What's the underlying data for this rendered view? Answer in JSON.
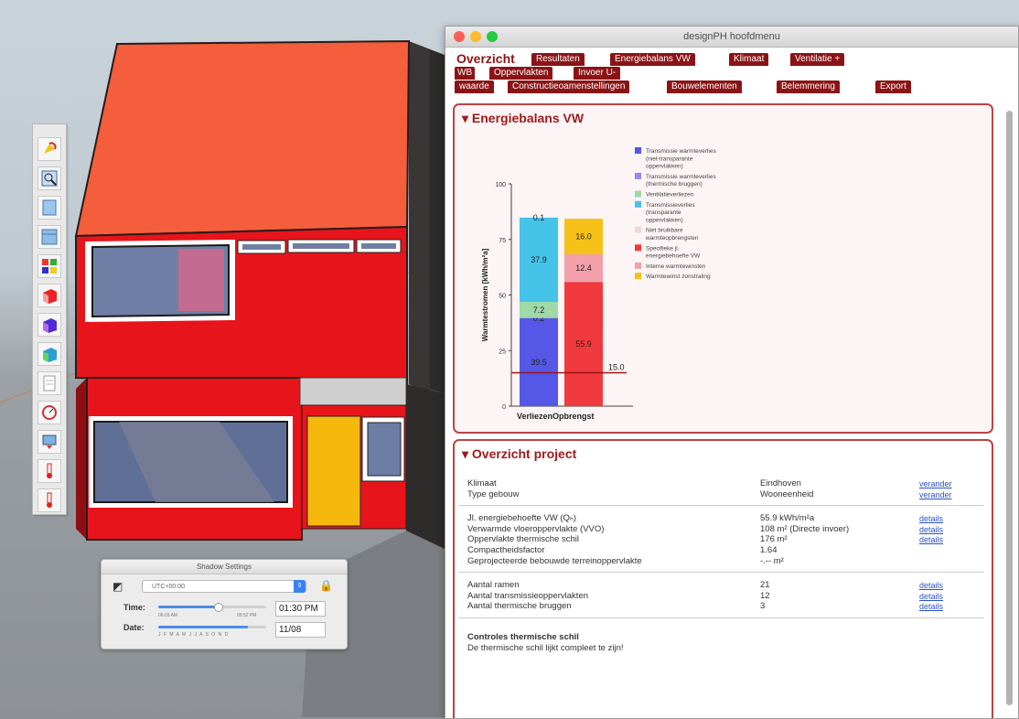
{
  "app": {
    "window_title": "designPH hoofdmenu"
  },
  "colors": {
    "accent": "#8b1316",
    "section_border": "#b94447",
    "link": "#2b52c7"
  },
  "nav": {
    "tabs": [
      {
        "label": "Overzicht",
        "active": true
      },
      {
        "label": "Resultaten"
      },
      {
        "label": "Energiebalans VW"
      },
      {
        "label": "Klimaat"
      },
      {
        "label": "Ventilatie +"
      },
      {
        "label": "WB"
      },
      {
        "label": "Oppervlakten"
      },
      {
        "label": "Invoer U-"
      },
      {
        "label": "waarde"
      },
      {
        "label": "Constructieoamenstellingen"
      },
      {
        "label": "Bouwelementen"
      },
      {
        "label": "Belemmering"
      },
      {
        "label": "Export"
      }
    ]
  },
  "energy_section": {
    "title": "▾ Energiebalans VW"
  },
  "chart_data": {
    "type": "bar",
    "stacked": true,
    "categories": [
      "Verliezen",
      "Opbrengst"
    ],
    "category_label_text": "VerliezenOpbrengst",
    "ylabel": "Warmtestromen [kWh/m²a]",
    "ylim": [
      0,
      100
    ],
    "yticks": [
      0,
      25,
      50,
      75,
      100
    ],
    "legend_position": "right",
    "reference_line": {
      "value": 15.0,
      "label": "15.0"
    },
    "series": [
      {
        "name": "Transmissie warmteverlies (niet-transparante oppervlakken)",
        "color": "#5558e6",
        "values": [
          39.5,
          0
        ],
        "label": "39.5"
      },
      {
        "name": "Transmissie warmteverlies (thermische bruggen)",
        "color": "#9b84f2",
        "values": [
          0.2,
          0
        ],
        "label": "0.2"
      },
      {
        "name": "Ventilatieverliezen",
        "color": "#9ed9a7",
        "values": [
          7.2,
          0
        ],
        "label": "7.2"
      },
      {
        "name": "Transmissieverlies (transparante oppervlakken)",
        "color": "#45c3e8",
        "values": [
          37.9,
          0
        ],
        "label": "37.9"
      },
      {
        "name": "Niet bruikbare warmteopbrengsten",
        "color": "#eed6d6",
        "values": [
          0.1,
          0
        ],
        "label": "0.1"
      },
      {
        "name": "Specifieke jl. energiebehoefte VW",
        "color": "#f03a3e",
        "values": [
          0,
          55.9
        ],
        "label": "55.9"
      },
      {
        "name": "Interne warmtewinsten",
        "color": "#f2a0aa",
        "values": [
          0,
          12.4
        ],
        "label": "12.4"
      },
      {
        "name": "Warmtewinst zonstraling",
        "color": "#f6c118",
        "values": [
          0,
          16.0
        ],
        "label": "16.0"
      }
    ],
    "legend_lines": [
      [
        "Transmissie warmteverlies",
        "(niet-transparante",
        "oppervlakken)"
      ],
      [
        "Transmissie warmteverlies",
        "(thermische bruggen)"
      ],
      [
        "Ventilatieverliezen"
      ],
      [
        "Transmissieverlies",
        "(transparante",
        "oppervlakken)"
      ],
      [
        "Niet bruikbare",
        "warmteopbrengsten"
      ],
      [
        "Specifieke jl.",
        "energiebehoefte VW"
      ],
      [
        "Interne warmtewinsten"
      ],
      [
        "Warmtewinst zonstraling"
      ]
    ]
  },
  "overview": {
    "title": "▾ Overzicht project",
    "groups": [
      [
        {
          "label": "Klimaat",
          "value": "Eindhoven",
          "link": "verander"
        },
        {
          "label": "Type gebouw",
          "value": "Wooneenheid",
          "link": "verander"
        }
      ],
      [
        {
          "label": "Jl. energiebehoefte VW (Qₕ)",
          "value": "55.9 kWh/m²a",
          "link": "details"
        },
        {
          "label": "Verwarmde vloeroppervlakte (VVO)",
          "value": "108 m² (Directe invoer)",
          "link": "details"
        },
        {
          "label": "Oppervlakte thermische schil",
          "value": "176 m²",
          "link": "details"
        },
        {
          "label": "Compactheidsfactor",
          "value": "1.64",
          "link": ""
        },
        {
          "label": "Geprojecteerde bebouwde terreinoppervlakte",
          "value": "-.-- m²",
          "link": ""
        }
      ],
      [
        {
          "label": "Aantal ramen",
          "value": "21",
          "link": "details"
        },
        {
          "label": "Aantal transmissieoppervlakten",
          "value": "12",
          "link": "details"
        },
        {
          "label": "Aantal thermische bruggen",
          "value": "3",
          "link": "details"
        }
      ]
    ],
    "controls_title": "Controles thermische schil",
    "controls_text": "De thermische schil lijkt compleet te zijn!"
  },
  "shadow_settings": {
    "title": "Shadow Settings",
    "timezone": "UTC+00:00",
    "time_label": "Time:",
    "date_label": "Date:",
    "time_min": "06:03 AM",
    "time_max": "09:52 PM",
    "time_value": "01:30 PM",
    "date_value": "11/08",
    "months": "J F M A M J J A S O N D",
    "time_fraction": 0.55,
    "date_fraction": 0.83
  },
  "toolbar": {
    "tools": [
      "paint-bucket-icon",
      "zoom-extents-icon",
      "sheet-icon",
      "window-icon",
      "components-icon",
      "building-block-red-icon",
      "building-block-purple-icon",
      "building-block-green-icon",
      "document-icon",
      "gauge-icon",
      "export-icon",
      "thermometer-icon",
      "thermometer-icon"
    ]
  }
}
